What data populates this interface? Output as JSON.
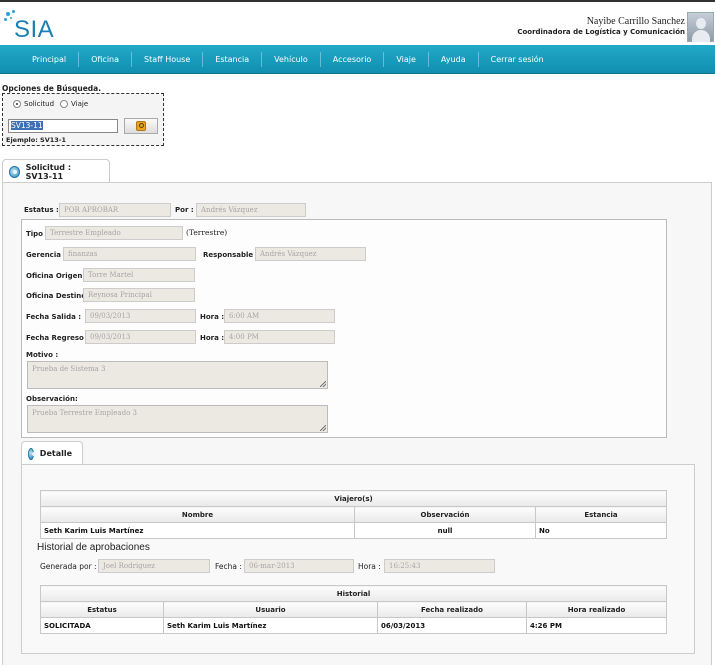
{
  "app": {
    "logo_text": "SIA",
    "user_name": "Nayibe Carrillo Sanchez",
    "user_role": "Coordinadora de Logística y Comunicación"
  },
  "nav": {
    "items": [
      "Principal",
      "Oficina",
      "Staff House",
      "Estancia",
      "Vehículo",
      "Accesorio",
      "Viaje",
      "Ayuda",
      "Cerrar sesión"
    ]
  },
  "search": {
    "title": "Opciones de Búsqueda.",
    "option_solicitud": "Solicitud",
    "option_viaje": "Viaje",
    "selected_option": "Solicitud",
    "value": "SV13-11",
    "example": "Ejemplo: SV13-1",
    "button_icon": "search-icon"
  },
  "tab_main": {
    "label": "Solicitud : SV13-11"
  },
  "request": {
    "estatus_label": "Estatus :",
    "estatus_value": "POR APROBAR",
    "por_label": "Por :",
    "por_value": "Andrés Vázquez",
    "tipo_label": "Tipo :",
    "tipo_value": "Terrestre Empleado",
    "tipo_note": "(Terrestre)",
    "gerencia_label": "Gerencia :",
    "gerencia_value": "finanzas",
    "responsable_label": "Responsable :",
    "responsable_value": "Andrés Vázquez",
    "origen_label": "Oficina Origen :",
    "origen_value": "Torre Martel",
    "destino_label": "Oficina Destino :",
    "destino_value": "Reynosa Principal",
    "fecha_salida_label": "Fecha Salida :",
    "fecha_salida_value": "09/03/2013",
    "hora_salida_label": "Hora :",
    "hora_salida_value": "6:00 AM",
    "fecha_regreso_label": "Fecha Regreso :",
    "fecha_regreso_value": "09/03/2013",
    "hora_regreso_label": "Hora :",
    "hora_regreso_value": "4:00 PM",
    "motivo_label": "Motivo :",
    "motivo_value": "Prueba de Sistema 3",
    "observacion_label": "Observación:",
    "observacion_value": "Prueba Terrestre Empleado 3"
  },
  "tab_detail": {
    "label": "Detalle"
  },
  "travelers": {
    "caption": "Viajero(s)",
    "headers": [
      "Nombre",
      "Observación",
      "Estancia"
    ],
    "rows": [
      [
        "Seth Karim Luis Martínez",
        "null",
        "No"
      ]
    ]
  },
  "approval": {
    "heading": "Historial de aprobaciones",
    "generated_label": "Generada por :",
    "generated_value": "Joel Rodriguez",
    "fecha_label": "Fecha :",
    "fecha_value": "06-mar-2013",
    "hora_label": "Hora :",
    "hora_value": "16:25:43"
  },
  "history": {
    "caption": "Historial",
    "headers": [
      "Estatus",
      "Usuario",
      "Fecha realizado",
      "Hora realizado"
    ],
    "rows": [
      [
        "SOLICITADA",
        "Seth Karim Luis Martínez",
        "06/03/2013",
        "4:26 PM"
      ]
    ]
  }
}
